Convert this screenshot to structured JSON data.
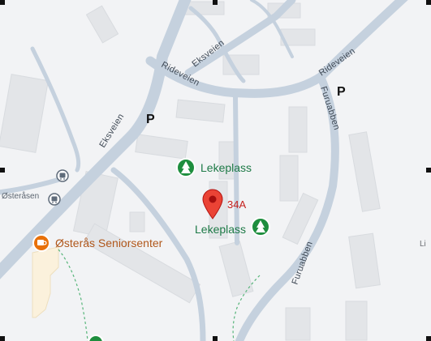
{
  "roads": {
    "eksveien_main": "Eksveien",
    "eksveien_branch": "Eksveien",
    "rideveien_left": "Rideveien",
    "rideveien_right": "Rideveien",
    "furuabben_top": "Furuabben",
    "furuabben_bottom": "Furuabben",
    "osteraasen": "Østeråsen"
  },
  "pois": {
    "playground_1": "Lekeplass",
    "playground_2": "Lekeplass",
    "senior_center": "Østerås Seniorsenter",
    "pin_label": "34A",
    "parking_1": "P",
    "parking_2": "P",
    "edge_text": "Li"
  },
  "colors": {
    "land": "#f2f3f5",
    "road": "#c5d1de",
    "building": "#e3e5e8",
    "park_icon": "#1e8e3e",
    "pin": "#ea4335",
    "poi_orange": "#e8710a",
    "senior_area": "#fbf1dc",
    "footpath": "#57b57a"
  },
  "icons": [
    "tree-icon",
    "map-pin-icon",
    "bus-stop-icon",
    "cafe-icon",
    "parking-icon"
  ]
}
